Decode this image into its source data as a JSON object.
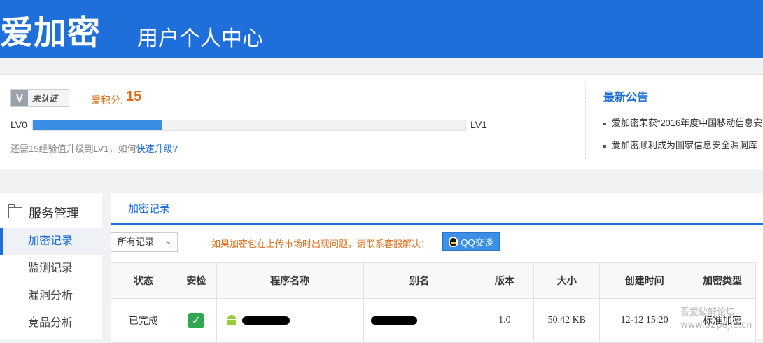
{
  "header": {
    "logo": "爱加密",
    "subtitle": "用户个人中心"
  },
  "level": {
    "badge_icon_text": "V",
    "badge_text": "未认证",
    "score_label": "爱积分:",
    "score_value": "15",
    "lv_start": "LV0",
    "lv_end": "LV1",
    "progress_fraction": 0.3,
    "tip_prefix": "还需15经验值升级到LV1，如何",
    "tip_link": "快速升级?"
  },
  "notices": {
    "title": "最新公告",
    "items": [
      "爱加密荣获“2016年度中国移动信息安",
      "爱加密顺利成为国家信息安全漏洞库"
    ]
  },
  "sidebar": {
    "heading": "服务管理",
    "items": [
      {
        "label": "加密记录",
        "active": true
      },
      {
        "label": "监测记录",
        "active": false
      },
      {
        "label": "漏洞分析",
        "active": false
      },
      {
        "label": "竞品分析",
        "active": false
      }
    ]
  },
  "main": {
    "tab": "加密记录",
    "filter_value": "所有记录",
    "warning": "如果加密包在上传市场时出现问题，请联系客服解决：",
    "qq_button": "QQ交谈",
    "table": {
      "headers": [
        "状态",
        "安检",
        "程序名称",
        "别名",
        "版本",
        "大小",
        "创建时间",
        "加密类型"
      ],
      "rows": [
        {
          "status": "已完成",
          "version": "1.0",
          "size": "50.42 KB",
          "created": "12-12 15:20",
          "type": "标准加密"
        }
      ]
    }
  },
  "watermark": {
    "line1": "吾爱破解论坛",
    "line2": "www.52pojie.cn"
  },
  "colors": {
    "brand": "#1e6fd9",
    "warning": "#e06c1b",
    "success": "#3c9b2e"
  }
}
